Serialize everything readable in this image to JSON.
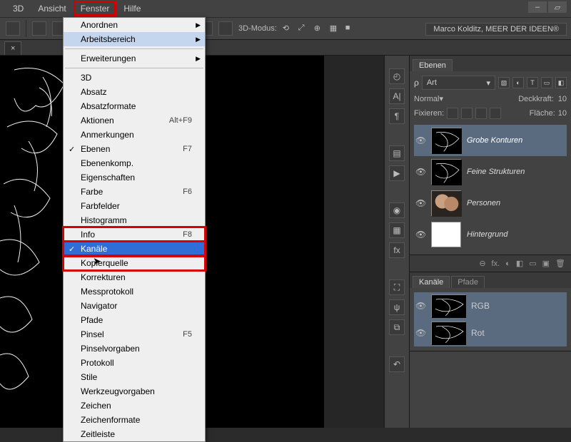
{
  "menubar": {
    "items": [
      "3D",
      "Ansicht",
      "Fenster",
      "Hilfe"
    ],
    "highlighted_index": 2
  },
  "toolbar": {
    "mode_label": "3D-Modus:"
  },
  "brand": "Marco Kolditz, MEER DER IDEEN®",
  "doctab": {
    "close": "×"
  },
  "dropdown": {
    "groups": [
      [
        {
          "label": "Anordnen",
          "submenu": true
        },
        {
          "label": "Arbeitsbereich",
          "submenu": true,
          "sub_hl": true
        }
      ],
      [
        {
          "label": "Erweiterungen",
          "submenu": true
        }
      ],
      [
        {
          "label": "3D"
        },
        {
          "label": "Absatz"
        },
        {
          "label": "Absatzformate"
        },
        {
          "label": "Aktionen",
          "shortcut": "Alt+F9"
        },
        {
          "label": "Anmerkungen"
        },
        {
          "label": "Ebenen",
          "shortcut": "F7",
          "checked": true
        },
        {
          "label": "Ebenenkomp."
        },
        {
          "label": "Eigenschaften"
        },
        {
          "label": "Farbe",
          "shortcut": "F6"
        },
        {
          "label": "Farbfelder"
        },
        {
          "label": "Histogramm"
        },
        {
          "label": "Info",
          "shortcut": "F8",
          "red_outline": true
        },
        {
          "label": "Kanäle",
          "checked": true,
          "selected": true,
          "red_outline": true
        },
        {
          "label": "Kopierquelle",
          "red_outline": true
        },
        {
          "label": "Korrekturen"
        },
        {
          "label": "Messprotokoll"
        },
        {
          "label": "Navigator"
        },
        {
          "label": "Pfade"
        },
        {
          "label": "Pinsel",
          "shortcut": "F5"
        },
        {
          "label": "Pinselvorgaben"
        },
        {
          "label": "Protokoll"
        },
        {
          "label": "Stile"
        },
        {
          "label": "Werkzeugvorgaben"
        },
        {
          "label": "Zeichen"
        },
        {
          "label": "Zeichenformate"
        },
        {
          "label": "Zeitleiste"
        }
      ]
    ]
  },
  "panels": {
    "layers": {
      "tab": "Ebenen",
      "kind_label": "Art",
      "kind_icon": "ρ",
      "blend": "Normal",
      "opacity_label": "Deckkraft:",
      "opacity_value": "10",
      "fix_label": "Fixieren:",
      "fill_label": "Fläche:",
      "fill_value": "10",
      "items": [
        {
          "name": "Grobe Konturen",
          "thumb": "edges",
          "sel": true
        },
        {
          "name": "Feine Strukturen",
          "thumb": "edges"
        },
        {
          "name": "Personen",
          "thumb": "photo"
        },
        {
          "name": "Hintergrund",
          "thumb": "white",
          "italic": true
        }
      ],
      "footer_icons": [
        "⊖",
        "fx.",
        "◐",
        "◧",
        "▭",
        "▣",
        "🗑"
      ]
    },
    "channels": {
      "tabs": [
        "Kanäle",
        "Pfade"
      ],
      "items": [
        {
          "name": "RGB",
          "sel": true
        },
        {
          "name": "Rot",
          "sel": true
        }
      ]
    }
  }
}
